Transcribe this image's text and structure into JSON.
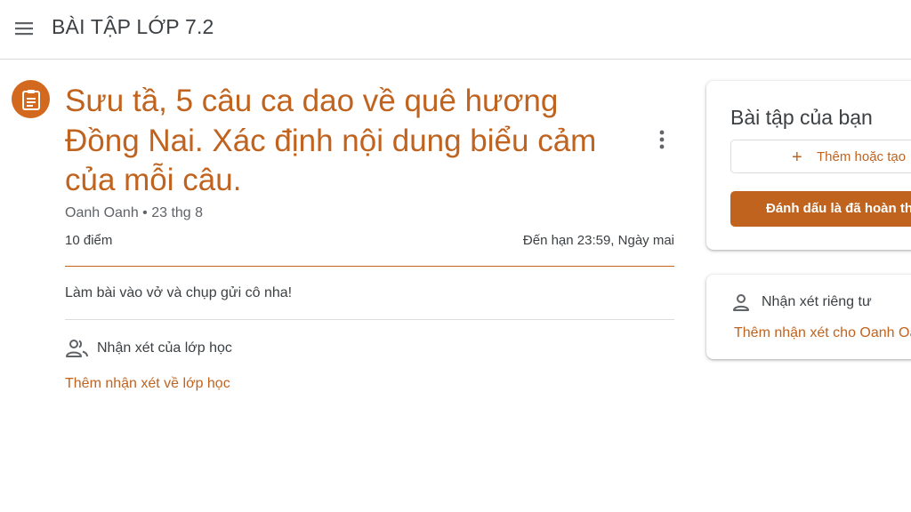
{
  "header": {
    "title": "BÀI TẬP LỚP 7.2"
  },
  "assignment": {
    "title": "Sưu tầ, 5 câu ca dao về quê hương Đồng Nai. Xác định nội dung biểu cảm của mỗi câu.",
    "meta": "Oanh Oanh • 23 thg 8",
    "points": "10 điểm",
    "due": "Đến hạn 23:59, Ngày mai",
    "instructions": "Làm bài vào vở và chụp gửi cô nha!",
    "class_comments_label": "Nhận xét của lớp học",
    "add_class_comment": "Thêm nhận xét về lớp học"
  },
  "your_work": {
    "title": "Bài tập của bạn",
    "add_button": "Thêm hoặc tạo",
    "mark_done_button": "Đánh dấu là đã hoàn thành"
  },
  "private_comments": {
    "label": "Nhận xét riêng tư",
    "add_link": "Thêm nhận xét cho Oanh Oanh"
  },
  "colors": {
    "accent": "#c0631f",
    "icon_bg": "#d2691e",
    "text": "#3c4043",
    "muted": "#5f6368",
    "border": "#dadce0"
  },
  "icons": {
    "menu": "hamburger-menu-icon",
    "assignment": "clipboard-icon",
    "more": "more-vert-icon",
    "people": "people-icon",
    "person": "person-icon",
    "plus": "plus-icon"
  }
}
